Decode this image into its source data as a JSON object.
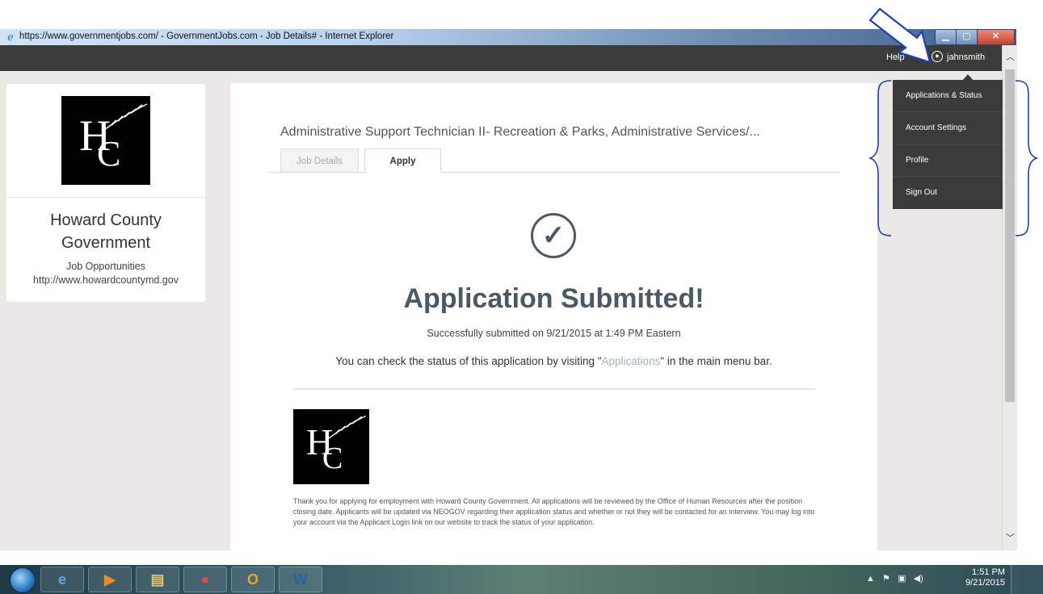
{
  "window": {
    "title": "https://www.governmentjobs.com/ - GovernmentJobs.com - Job Details# - Internet Explorer",
    "min_symbol": "▁",
    "max_symbol": "▢",
    "close_symbol": "✕"
  },
  "header": {
    "help": "Help",
    "username": "jahnsmith"
  },
  "user_menu": {
    "items": [
      {
        "label": "Applications & Status"
      },
      {
        "label": "Account Settings"
      },
      {
        "label": "Profile"
      },
      {
        "label": "Sign Out"
      }
    ]
  },
  "organization": {
    "name_line1": "Howard County",
    "name_line2": "Government",
    "subtitle": "Job Opportunities",
    "url": "http://www.howardcountymd.gov"
  },
  "job": {
    "title": "Administrative Support Technician II- Recreation & Parks, Administrative Services/...",
    "tabs": [
      {
        "label": "Job Details",
        "active": false
      },
      {
        "label": "Apply",
        "active": true
      }
    ]
  },
  "confirmation": {
    "heading": "Application Submitted!",
    "submitted_on": "Successfully submitted on 9/21/2015 at 1:49 PM Eastern",
    "status_prefix": "You can check the status of this application by visiting \"",
    "status_link": "Applications",
    "status_suffix": "\" in the main menu bar.",
    "message": "Thank you for applying for employment with Howard County Government. All applications will be reviewed by the Office of Human Resources after the position closing date. Applicants will be updated via NEOGOV regarding their application status and whether or not they will be contacted for an interview. You may log into your account via the Applicant Login link on our website to track the status of your application."
  },
  "taskbar": {
    "apps": [
      {
        "icon": "internet-explorer-icon",
        "glyph": "e",
        "color": "#5aa6e6"
      },
      {
        "icon": "media-player-icon",
        "glyph": "▶",
        "color": "#f08a24"
      },
      {
        "icon": "file-explorer-icon",
        "glyph": "▤",
        "color": "#e9c464"
      },
      {
        "icon": "chrome-icon",
        "glyph": "●",
        "color": "#e04b3c"
      },
      {
        "icon": "outlook-icon",
        "glyph": "O",
        "color": "#f2a31b"
      },
      {
        "icon": "word-icon",
        "glyph": "W",
        "color": "#2b5ea8"
      }
    ],
    "time": "1:51 PM",
    "date": "9/21/2015"
  }
}
